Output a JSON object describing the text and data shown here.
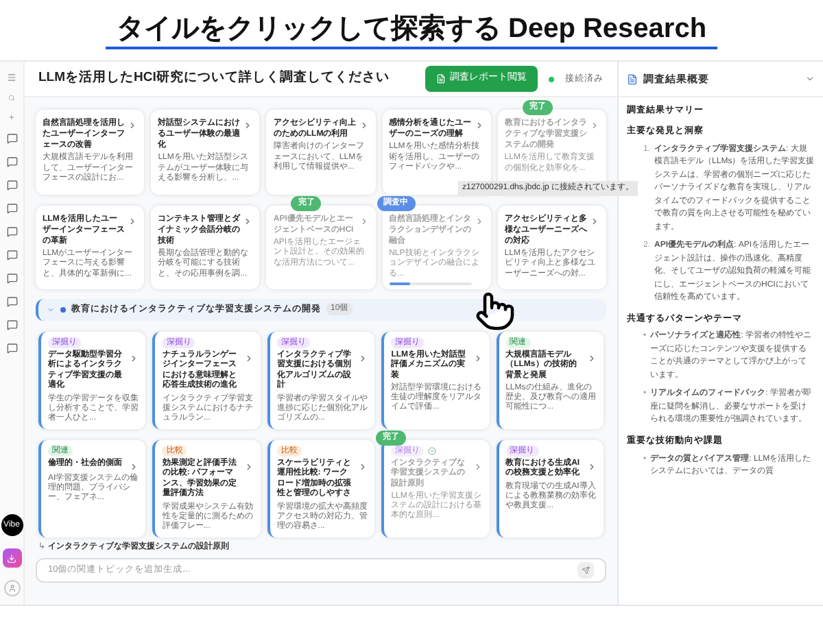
{
  "slide_title": "タイルをクリックして探索する Deep Research",
  "rail": {
    "brand": "Vibe"
  },
  "header": {
    "title": "LLMを活用したHCI研究について詳しく調査してください",
    "report_button": "調査レポート閲覧",
    "status": {
      "label": "接続済み",
      "connected": true
    }
  },
  "topics": [
    {
      "title": "自然言語処理を活用したユーザーインターフェースの改善",
      "summary": "大規模言語モデルを利用して、ユーザーインターフェースの設計にお...",
      "status": {
        "kind": "none"
      }
    },
    {
      "title": "対話型システムにおけるユーザー体験の最適化",
      "summary": "LLMを用いた対話型システムがユーザー体験に与える影響を分析し、...",
      "status": {
        "kind": "none"
      }
    },
    {
      "title": "アクセシビリティ向上のためのLLMの利用",
      "summary": "障害者向けのインターフェースにおいて、LLMを利用して情報提供や...",
      "status": {
        "kind": "none"
      }
    },
    {
      "title": "感情分析を通じたユーザーのニーズの理解",
      "summary": "LLMを用いた感情分析技術を活用し、ユーザーのフィードバックや...",
      "status": {
        "kind": "none"
      }
    },
    {
      "title": "教育におけるインタラクティブな学習支援システムの開発",
      "summary": "LLMを活用して教育支援の個別化と効率化を...",
      "status": {
        "kind": "done",
        "label": "完了"
      }
    },
    {
      "title": "LLMを活用したユーザーインターフェースの革新",
      "summary": "LLMがユーザーインターフェースに与える影響と、具体的な革新例に...",
      "status": {
        "kind": "none"
      }
    },
    {
      "title": "コンテキスト管理とダイナミック会話分岐の技術",
      "summary": "長期な会話管理と動的な分岐を可能にする技術と、その応用事例を調...",
      "status": {
        "kind": "none"
      }
    },
    {
      "title": "API優先モデルとエージェントベースのHCI",
      "summary": "APIを活用したエージェント設計と、その効果的な活用方法について...",
      "status": {
        "kind": "done",
        "label": "完了"
      }
    },
    {
      "title": "自然言語処理とインタラクションデザインの融合",
      "summary": "NLP技術とインタラクションデザインの融合による...",
      "status": {
        "kind": "active",
        "label": "調査中",
        "level": 0.25
      }
    },
    {
      "title": "アクセシビリティと多様なユーザーニーズへの対応",
      "summary": "LLMを活用したアクセシビリティ向上と多様なユーザーニーズへの対...",
      "status": {
        "kind": "none"
      }
    }
  ],
  "tooltip": "z127000291.dhs.jbdc.jp に接続されています。",
  "section": {
    "title": "教育におけるインタラクティブな学習支援システムの開発",
    "count": "10個",
    "expanded": true,
    "cards": [
      {
        "tag": {
          "label": "深掘り",
          "kind": "deep"
        },
        "title": "データ駆動型学習分析によるインタラクティブ学習支援の最適化",
        "summary": "学生の学習データを収集し分析することで、学習者一人ひと..."
      },
      {
        "tag": {
          "label": "深掘り",
          "kind": "deep"
        },
        "title": "ナチュラルランゲージインターフェースにおける意味理解と応答生成技術の進化",
        "summary": "インタラクティブ学習支援システムにおけるナチュラルラン..."
      },
      {
        "tag": {
          "label": "深掘り",
          "kind": "deep"
        },
        "title": "インタラクティブ学習支援における個別化アルゴリズムの設計",
        "summary": "学習者の学習スタイルや進捗に応じた個別化アルゴリズムの..."
      },
      {
        "tag": {
          "label": "深掘り",
          "kind": "deep"
        },
        "title": "LLMを用いた対話型評価メカニズムの実装",
        "summary": "対話型学習環境における生徒の理解度をリアルタイムで評価..."
      },
      {
        "tag": {
          "label": "関連",
          "kind": "related"
        },
        "title": "大規模言語モデル（LLMs）の技術的背景と発展",
        "summary": "LLMsの仕組み、進化の歴史、及び教育への適用可能性につ..."
      },
      {
        "tag": {
          "label": "関連",
          "kind": "related"
        },
        "title": "倫理的・社会的側面",
        "summary": "AI学習支援システムの倫理的問題、プライバシー、フェアネ..."
      },
      {
        "tag": {
          "label": "比較",
          "kind": "compare"
        },
        "title": "効果測定と評価手法の比較: パフォーマンス、学習効果の定量評価方法",
        "summary": "学習成果やシステム有効性を定量的に測るための評価フレー..."
      },
      {
        "tag": {
          "label": "比較",
          "kind": "compare"
        },
        "title": "スケーラビリティと運用性比較: ワークロード増加時の拡張性と管理のしやすさ",
        "summary": "学習環境の拡大や高頻度アクセス時の対応力、管理の容易さ..."
      },
      {
        "tag": {
          "label": "深掘り",
          "kind": "deep"
        },
        "title": "インタラクティブな学習支援システムの設計原則",
        "summary": "LLMを用いた学習支援システムの設計における基本的な原則...",
        "done": "完了"
      },
      {
        "tag": {
          "label": "深掘り",
          "kind": "deep"
        },
        "title": "教育における生成AIの校務支援と効率化",
        "summary": "教育現場での生成AI導入による教務業務の効率化や教員支援..."
      }
    ]
  },
  "subtopic": {
    "marker": "↳",
    "title": "インタラクティブな学習支援システムの設計原則"
  },
  "input": {
    "placeholder": "10個の関連トピックを追加生成..."
  },
  "summary": {
    "title": "調査結果概要",
    "blocks": [
      {
        "kind": "h1",
        "text": "調査結果サマリー"
      },
      {
        "kind": "h2",
        "text": "主要な発見と洞察"
      },
      {
        "kind": "numbered",
        "marker": "1.",
        "text": "**インタラクティブ学習支援システム**: 大規模言語モデル（LLMs）を活用した学習支援システムは、学習者の個別ニーズに応じたパーソナライズドな教育を実現し、リアルタイムでのフィードバックを提供することで教育の質を向上させる可能性を秘めています。"
      },
      {
        "kind": "numbered",
        "marker": "2.",
        "text": "**API優先モデルの利点**: APIを活用したエージェント設計は、操作の迅速化、高精度化、そしてユーザの認知負荷の軽減を可能にし、エージェントベースのHCIにおいて信頼性を高めています。"
      },
      {
        "kind": "h2",
        "text": "共通するパターンやテーマ"
      },
      {
        "kind": "bullet",
        "marker": "•",
        "text": "**パーソナライズと適応性**: 学習者の特性やニーズに応じたコンテンツや支援を提供することが共通のテーマとして浮かび上がっています。"
      },
      {
        "kind": "bullet",
        "marker": "•",
        "text": "**リアルタイムのフィードバック**: 学習者が即座に疑問を解消し、必要なサポートを受けられる環境の重要性が強調されています。"
      },
      {
        "kind": "h2",
        "text": "重要な技術動向や課題"
      },
      {
        "kind": "bullet",
        "marker": "•",
        "text": "**データの質とバイアス管理**: LLMを活用したシステムにおいては、データの質"
      }
    ]
  }
}
